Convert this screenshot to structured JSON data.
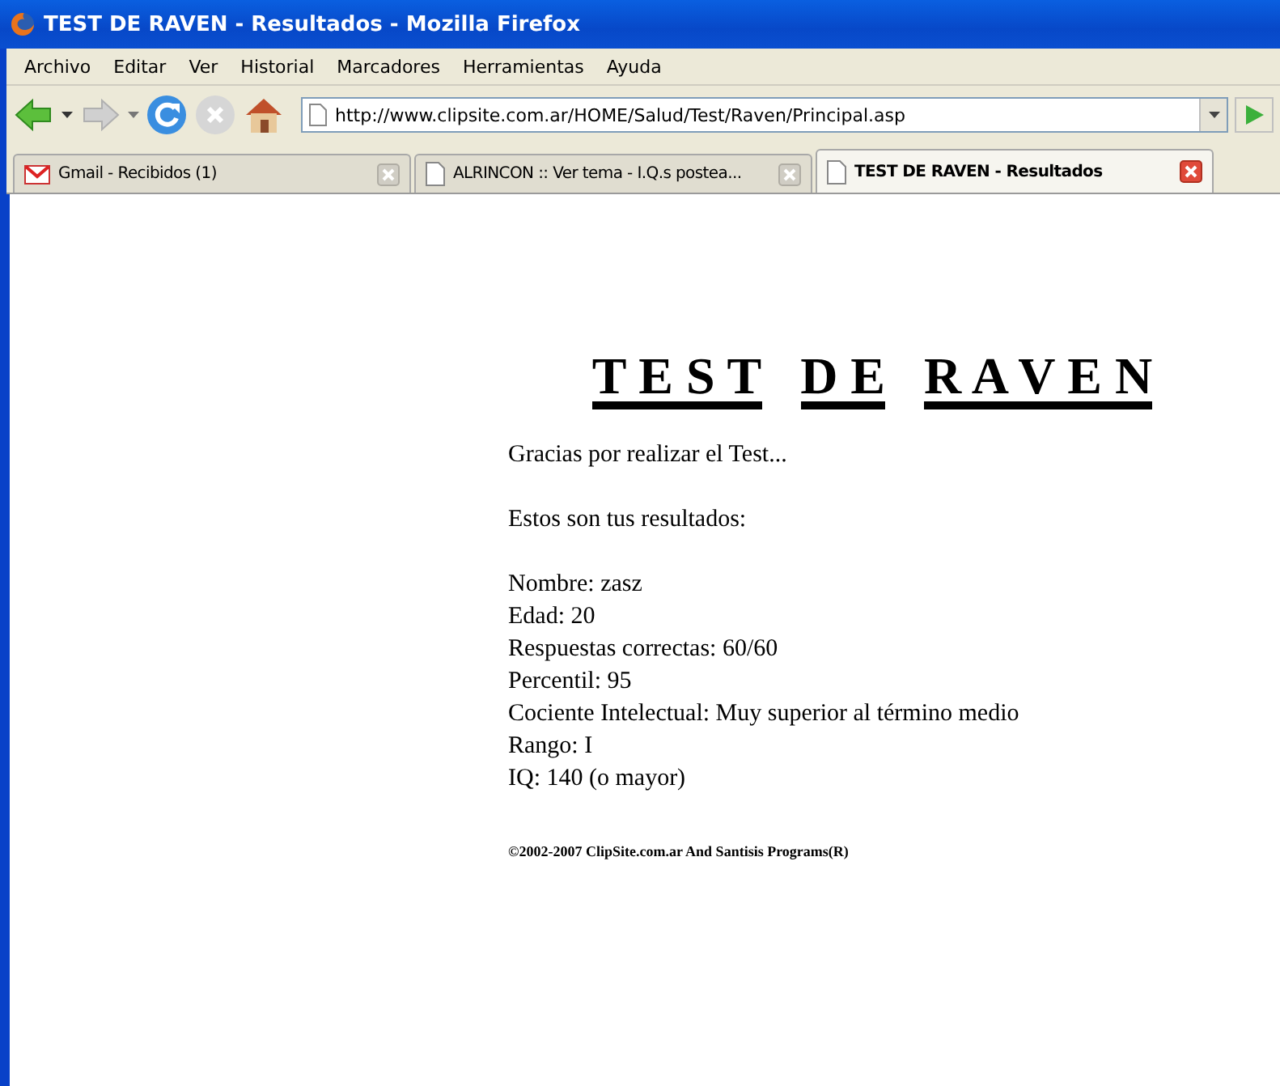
{
  "window": {
    "title": "TEST DE RAVEN - Resultados - Mozilla Firefox"
  },
  "menu": [
    "Archivo",
    "Editar",
    "Ver",
    "Historial",
    "Marcadores",
    "Herramientas",
    "Ayuda"
  ],
  "address_bar": {
    "value": "http://www.clipsite.com.ar/HOME/Salud/Test/Raven/Principal.asp"
  },
  "tabs": [
    {
      "label": "Gmail - Recibidos (1)",
      "kind": "mail",
      "selected": false
    },
    {
      "label": "ALRINCON :: Ver tema - I.Q.s postea...",
      "kind": "page",
      "selected": false
    },
    {
      "label": "TEST DE RAVEN - Resultados",
      "kind": "page",
      "selected": true
    }
  ],
  "page": {
    "heading": [
      "T E S T",
      "D E",
      "R A V E N"
    ],
    "intro": "Gracias por realizar el Test...",
    "subtitle": "Estos son tus resultados:",
    "results": [
      "Nombre: zasz",
      "Edad: 20",
      "Respuestas correctas: 60/60",
      "Percentil: 95",
      "Cociente Intelectual: Muy superior al término medio",
      "Rango: I",
      "IQ: 140 (o mayor)"
    ],
    "footer": "©2002-2007 ClipSite.com.ar And Santisis Programs(R)"
  }
}
